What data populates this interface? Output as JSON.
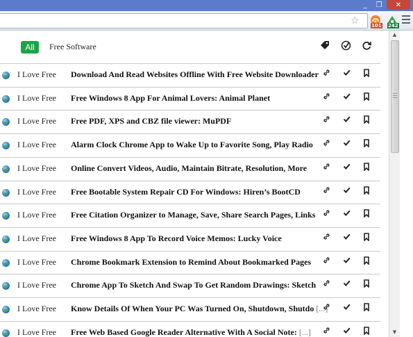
{
  "window": {
    "minimize_glyph": "_",
    "maximize_glyph": "❐",
    "close_glyph": "✕"
  },
  "toolbar": {
    "extensions": [
      {
        "icon": "reader-extension-icon",
        "badge": "101",
        "badge_color": "#d34a2a"
      },
      {
        "icon": "reader-extension-icon",
        "badge": "242",
        "badge_color": "#1a7a3c"
      }
    ]
  },
  "filters": {
    "active": "All",
    "category": "Free Software"
  },
  "header_icons": [
    "tag-icon",
    "check-circle-icon",
    "refresh-icon"
  ],
  "items": [
    {
      "source": "I Love Free",
      "title": "Download And Read Websites Offline With Free Website Downloader",
      "more": ""
    },
    {
      "source": "I Love Free",
      "title": "Free Windows 8 App For Animal Lovers: Animal Planet",
      "more": ""
    },
    {
      "source": "I Love Free",
      "title": "Free PDF, XPS and CBZ file viewer: MuPDF",
      "more": ""
    },
    {
      "source": "I Love Free",
      "title": "Alarm Clock Chrome App to Wake Up to Favorite Song, Play Radio",
      "more": ""
    },
    {
      "source": "I Love Free",
      "title": "Online Convert Videos, Audio, Maintain Bitrate, Resolution, More",
      "more": ""
    },
    {
      "source": "I Love Free",
      "title": "Free Bootable System Repair CD For Windows: Hiren’s BootCD",
      "more": ""
    },
    {
      "source": "I Love Free",
      "title": "Free Citation Organizer to Manage, Save, Share Search Pages, Links",
      "more": ""
    },
    {
      "source": "I Love Free",
      "title": "Free Windows 8 App To Record Voice Memos: Lucky Voice",
      "more": ""
    },
    {
      "source": "I Love Free",
      "title": "Chrome Bookmark Extension to Remind About Bookmarked Pages",
      "more": ""
    },
    {
      "source": "I Love Free",
      "title": "Chrome App To Sketch And Swap To Get Random Drawings: Sketch",
      "more": ""
    },
    {
      "source": "I Love Free",
      "title": "Know Details Of When Your PC Was Turned On, Shutdown, Shutdo",
      "more": "[...]"
    },
    {
      "source": "I Love Free",
      "title": "Free Web Based Google Reader Alternative With A Social Note:",
      "more": "[...]"
    }
  ],
  "row_icons": [
    "link-icon",
    "check-icon",
    "bookmark-icon"
  ],
  "colors": {
    "accent": "#1ea446",
    "titlebar": "#5a7ccb"
  }
}
